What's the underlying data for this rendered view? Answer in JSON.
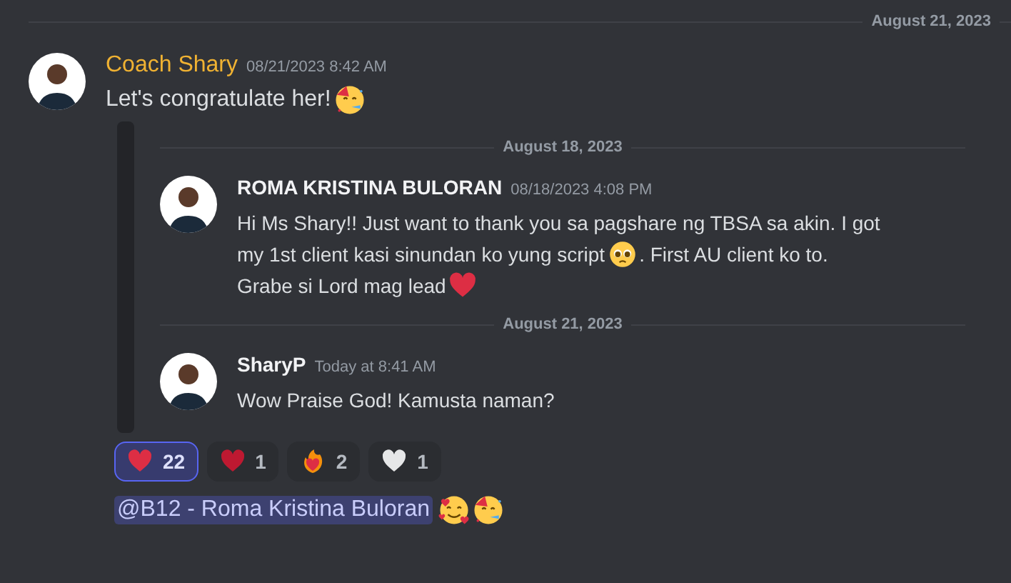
{
  "top_divider": {
    "date": "August 21, 2023"
  },
  "message": {
    "author": "Coach Shary",
    "timestamp": "08/21/2023 8:42 AM",
    "lines": [
      [
        {
          "kind": "text",
          "text": "Let's congratulate her!"
        },
        {
          "kind": "party-emoji"
        }
      ]
    ],
    "forwarded": [
      {
        "kind": "divider",
        "date": "August 18, 2023"
      },
      {
        "kind": "message",
        "author": "ROMA KRISTINA BULORAN",
        "timestamp": "08/18/2023 4:08 PM",
        "lines": [
          [
            {
              "kind": "text",
              "text": "Hi Ms Shary!! Just want to thank you sa pagshare ng TBSA sa akin. I got"
            }
          ],
          [
            {
              "kind": "text",
              "text": "my 1st client kasi sinundan ko yung script"
            },
            {
              "kind": "pleading-emoji"
            },
            {
              "kind": "text",
              "text": ". First AU client ko to."
            }
          ],
          [
            {
              "kind": "text",
              "text": "Grabe si Lord mag lead"
            },
            {
              "kind": "red-heart-emoji"
            }
          ]
        ]
      },
      {
        "kind": "divider",
        "date": "August 21, 2023"
      },
      {
        "kind": "message",
        "author": "SharyP",
        "timestamp": "Today at 8:41 AM",
        "lines": [
          [
            {
              "kind": "text",
              "text": "Wow Praise God! Kamusta naman?"
            }
          ]
        ]
      }
    ],
    "reactions": [
      {
        "kind": "red-heart-emoji",
        "count": "22",
        "selected": true
      },
      {
        "kind": "dark-heart-emoji",
        "count": "1",
        "selected": false
      },
      {
        "kind": "fire-heart-emoji",
        "count": "2",
        "selected": false
      },
      {
        "kind": "white-heart-emoji",
        "count": "1",
        "selected": false
      }
    ],
    "follow_up": [
      {
        "kind": "mention",
        "text": "@B12 - Roma Kristina Buloran"
      },
      {
        "kind": "hearts-face-emoji"
      },
      {
        "kind": "party-emoji"
      }
    ]
  }
}
